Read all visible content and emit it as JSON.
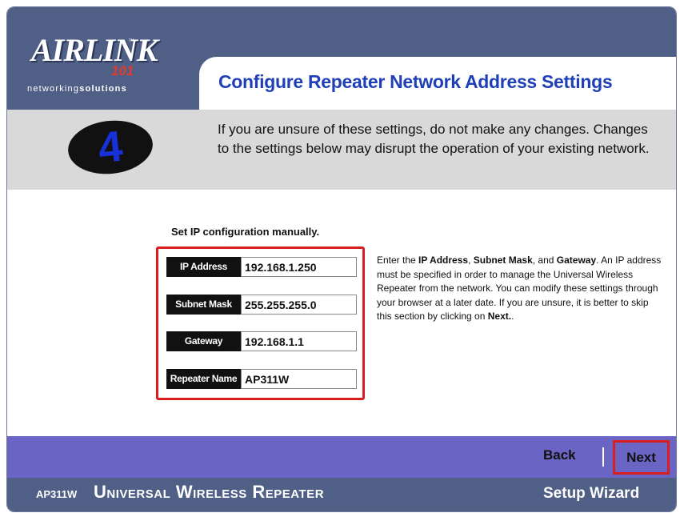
{
  "brand": {
    "logo_text": "AIRLINK",
    "logo_suffix": "101",
    "tagline_prefix": "networking",
    "tagline_suffix": "solutions"
  },
  "page": {
    "title": "Configure Repeater Network Address Settings",
    "step_number": "4",
    "notice": "If you are unsure of these settings, do not make any changes. Changes to the settings below may disrupt the operation of your existing network."
  },
  "form": {
    "heading": "Set IP configuration manually.",
    "fields": [
      {
        "label": "IP Address",
        "value": "192.168.1.250"
      },
      {
        "label": "Subnet Mask",
        "value": "255.255.255.0"
      },
      {
        "label": "Gateway",
        "value": "192.168.1.1"
      },
      {
        "label": "Repeater Name",
        "value": "AP311W"
      }
    ]
  },
  "help": {
    "p1": "Enter the ",
    "b1": "IP Address",
    "p2": ", ",
    "b2": "Subnet Mask",
    "p3": ", and ",
    "b3": "Gateway",
    "p4": ". An IP address must be specified in order to manage the Universal Wireless Repeater from the network. You can modify these settings through your browser at a later date. If you are unsure, it is better to skip this section by clicking on ",
    "b4": "Next.",
    "p5": "."
  },
  "nav": {
    "back_label": "Back",
    "next_label": "Next"
  },
  "footer": {
    "model": "AP311W",
    "product": "Universal Wireless Repeater",
    "wizard": "Setup Wizard"
  },
  "colors": {
    "header_bg": "#4f5f86",
    "title_blue": "#1f3fb8",
    "notice_bg": "#d9d9d9",
    "nav_bg": "#6a64c4",
    "highlight_red": "#d81e1e",
    "logo_red": "#e23b2e"
  }
}
